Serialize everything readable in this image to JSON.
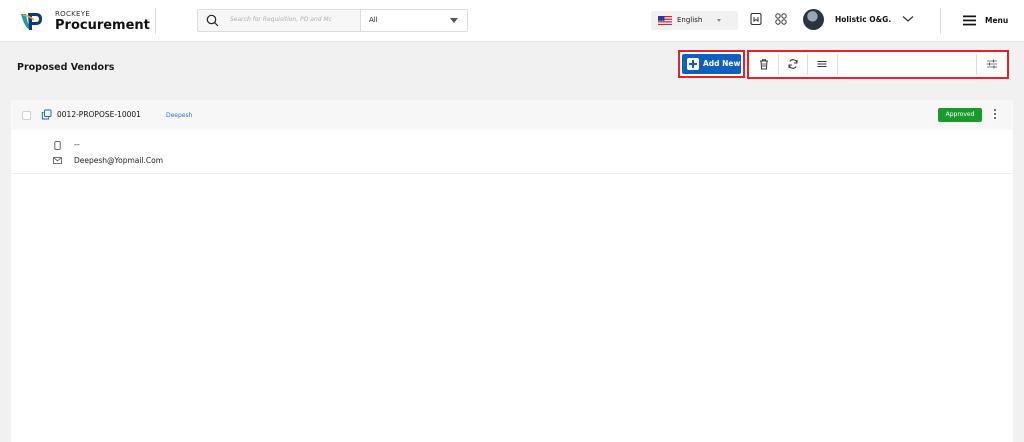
{
  "brand": {
    "small": "ROCKEYE",
    "big": "Procurement"
  },
  "header_search": {
    "placeholder": "Search for Requisition, PO and Mc",
    "scope": "All"
  },
  "language": {
    "label": "English",
    "flag_icon": "us-flag-icon"
  },
  "user": {
    "company": "Holistic O&G."
  },
  "menu": {
    "label": "Menu"
  },
  "page": {
    "title": "Proposed Vendors"
  },
  "toolbar": {
    "add_label": "Add New",
    "search_value": "",
    "icons": [
      "trash-icon",
      "refresh-icon",
      "list-icon",
      "search-icon",
      "filter-sliders-icon"
    ]
  },
  "vendors": [
    {
      "id": "0012-PROPOSE-10001",
      "name": "Deepesh",
      "status": "Approved",
      "phone": "--",
      "email": "Deepesh@Yopmail.Com"
    }
  ],
  "colors": {
    "primary": "#0f5fc1",
    "approved": "#1a9a2c",
    "highlight_border": "#e5212b",
    "link": "#2a6fd0"
  }
}
